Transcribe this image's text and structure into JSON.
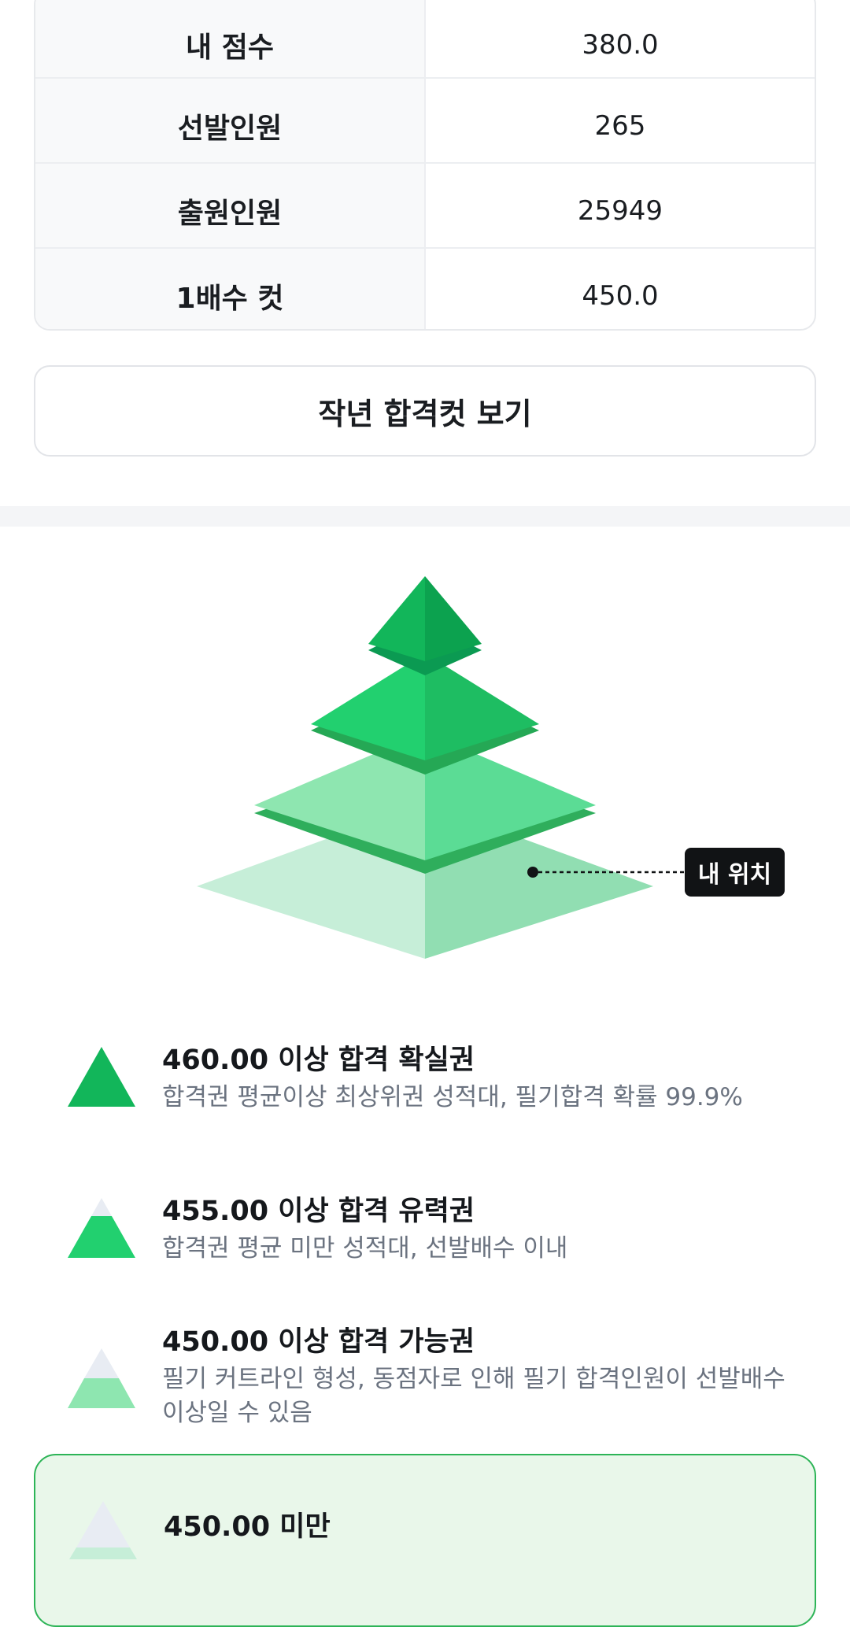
{
  "stats": {
    "rows": [
      {
        "label": "내 점수",
        "value": "380.0"
      },
      {
        "label": "선발인원",
        "value": "265"
      },
      {
        "label": "출원인원",
        "value": "25949"
      },
      {
        "label": "1배수 컷",
        "value": "450.0"
      }
    ]
  },
  "last_year_button": {
    "label": "작년 합격컷 보기"
  },
  "pyramid": {
    "my_position_label": "내 위치",
    "colors": {
      "tier1": "#12b65a",
      "tier2": "#22d06f",
      "tier3": "#8ee6b0",
      "tier4": "#c6eed8",
      "band": "#2daa5a",
      "tag_bg": "#111315"
    }
  },
  "legend": [
    {
      "title": "460.00 이상 합격 확실권",
      "desc": "합격권 평균이상 최상위권 성적대, 필기합격 확률 99.9%",
      "icon": "pyramid-tier-1-icon"
    },
    {
      "title": "455.00 이상 합격 유력권",
      "desc": "합격권 평균 미만 성적대, 선발배수 이내",
      "icon": "pyramid-tier-2-icon"
    },
    {
      "title": "450.00 이상 합격 가능권",
      "desc": "필기 커트라인 형성, 동점자로 인해 필기 합격인원이 선발배수 이상일 수 있음",
      "icon": "pyramid-tier-3-icon"
    },
    {
      "title": "450.00 미만",
      "desc": "",
      "icon": "pyramid-tier-4-icon"
    }
  ]
}
